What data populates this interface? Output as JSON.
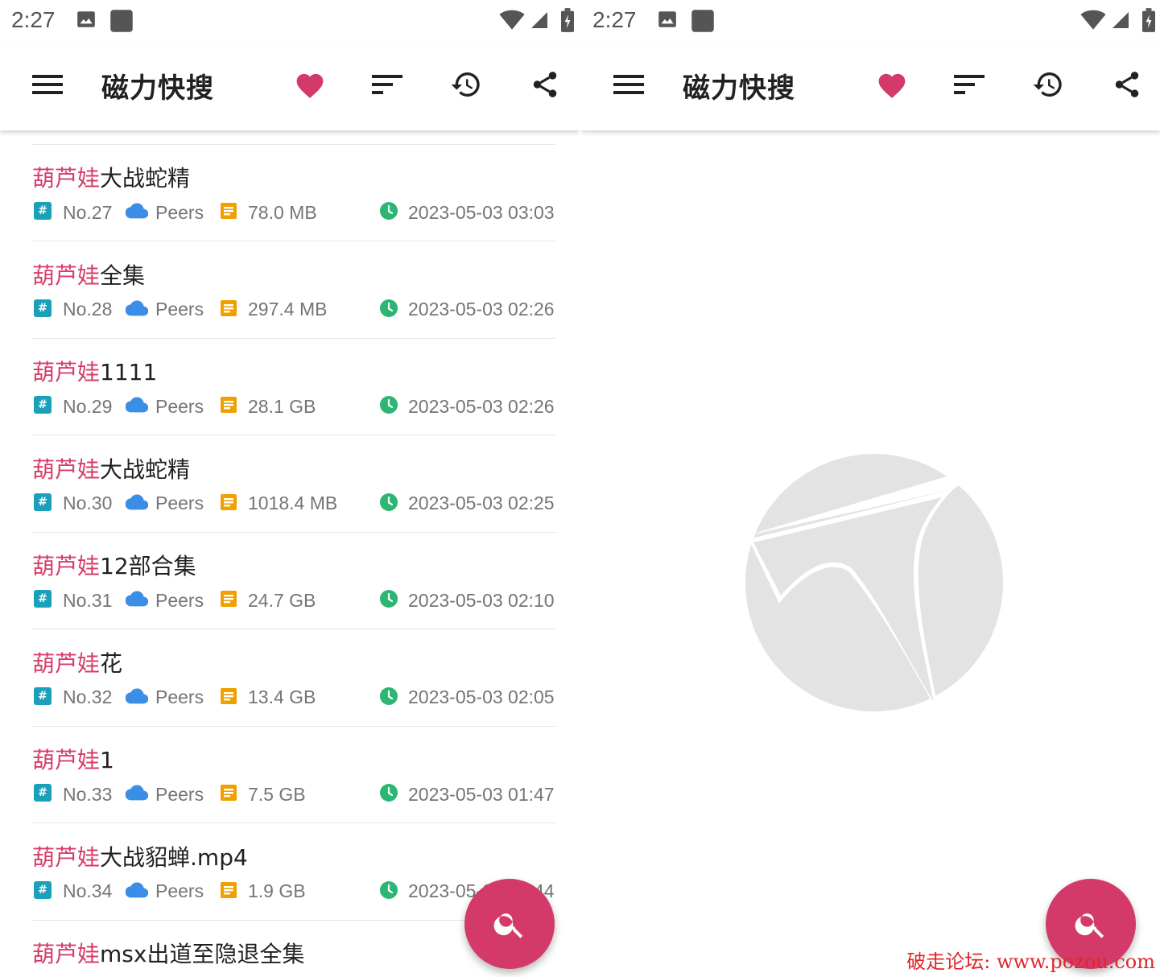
{
  "status_bar": {
    "time": "2:27"
  },
  "app_bar": {
    "title": "磁力快搜",
    "icons": [
      "menu-icon",
      "heart-icon",
      "sort-icon",
      "history-icon",
      "share-icon"
    ]
  },
  "colors": {
    "accent": "#d33a6a",
    "highlight_text": "#d63c6a",
    "hash_badge": "#1aa0b8",
    "cloud": "#3a8ee6",
    "file": "#f0a000",
    "clock": "#2bb673"
  },
  "results": [
    {
      "highlight": "葫芦娃",
      "rest": "大战蛇精",
      "no": "No.27",
      "source": "Peers",
      "size": "78.0 MB",
      "date": "2023-05-03 03:03"
    },
    {
      "highlight": "葫芦娃",
      "rest": "全集",
      "no": "No.28",
      "source": "Peers",
      "size": "297.4 MB",
      "date": "2023-05-03 02:26"
    },
    {
      "highlight": "葫芦娃",
      "rest": "1111",
      "no": "No.29",
      "source": "Peers",
      "size": "28.1 GB",
      "date": "2023-05-03 02:26"
    },
    {
      "highlight": "葫芦娃",
      "rest": "大战蛇精",
      "no": "No.30",
      "source": "Peers",
      "size": "1018.4 MB",
      "date": "2023-05-03 02:25"
    },
    {
      "highlight": "葫芦娃",
      "rest": "12部合集",
      "no": "No.31",
      "source": "Peers",
      "size": "24.7 GB",
      "date": "2023-05-03 02:10"
    },
    {
      "highlight": "葫芦娃",
      "rest": "花",
      "no": "No.32",
      "source": "Peers",
      "size": "13.4 GB",
      "date": "2023-05-03 02:05"
    },
    {
      "highlight": "葫芦娃",
      "rest": "1",
      "no": "No.33",
      "source": "Peers",
      "size": "7.5 GB",
      "date": "2023-05-03 01:47"
    },
    {
      "highlight": "葫芦娃",
      "rest": "大战貂蝉.mp4",
      "no": "No.34",
      "source": "Peers",
      "size": "1.9 GB",
      "date": "2023-05-03 01:44"
    },
    {
      "highlight": "葫芦娃",
      "rest": "msx出道至隐退全集",
      "no": "",
      "source": "",
      "size": "",
      "date": ""
    }
  ],
  "fab": {
    "icon": "search-icon"
  },
  "watermark": "破走论坛: www.pozou.com"
}
